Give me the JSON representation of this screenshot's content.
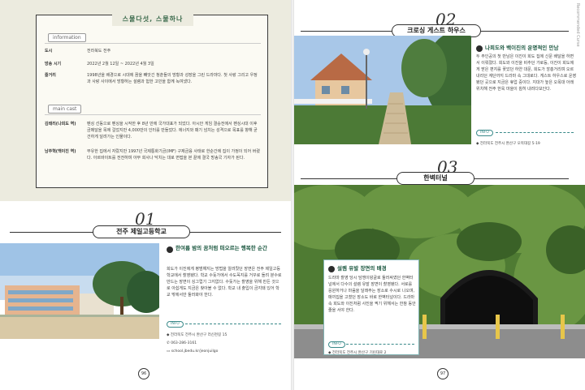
{
  "left_page": {
    "box_title": "스물다섯, 스물하나",
    "info_tag": "information",
    "info_rows": [
      {
        "key": "도시",
        "value": "전라북도 전주"
      },
      {
        "key": "방송 시기",
        "value": "2022년 2월 12일 ~ 2022년 4월 3일"
      },
      {
        "key": "줄거리",
        "value": "1998년을 배경으로 시대에 꿈을 빼앗긴 청춘들의 방황과 성장을 그린 드라마다. 첫 사랑 그리고 우정과 사랑 사이에서 방황하는 설렘과 험한 고민을 함께 녹여냈다."
      }
    ],
    "cast_tag": "main cast",
    "cast_rows": [
      {
        "key": "김태리(나희도 역)",
        "value": "펜싱 선동으로 펜싱을 시작한 후 8년 만에 국가대표가 되었다. 아시안 게임 결승전에서 펜싱시대 이후 금메달을 목에 걸었지만 4,000만의 인터를 만들었다. 에너지와 패기 넘치는 성격으로 목표를 향해 굳건하게 달려가는 인물이다."
      },
      {
        "key": "남주혁(백이진 역)",
        "value": "부유한 집에서 자랐지만 1997년 국제통화기금(IMF) 구제금융 사태로 한순간에 집이 가정이 되어 버렸다. 아르바이트를 전전하며 아무 회사나 닥치는 대로 면접을 본 끝에 결국 방송국 기자가 된다."
      }
    ],
    "section_num": "01",
    "section_title": "전주 제일고등학교",
    "card_title": "한여름 밤의 꿈처럼 떠오르는 행복한 순간",
    "card_text": "희도가 이진에게 평범해지는 방법을 알려줬던 장면은 전주 제일고등학교에서 촬영됐다. 학교 수돗가에서 수도꼭지를 거꾸로 돌려 분수로 만드는 장면이 싱그럽기 그지없다. 수돗가는 촬영을 위해 만든 것으로 아쉽게도 지금은 찾아볼 수 없다. 학교 내 출입이 금지돼 있어 학교 밖에서만 둘러봐야 한다.",
    "info_label": "INFO",
    "address": "전라북도 전주시 완산구 러신천길 15",
    "phone": "063-286-3161",
    "website": "school.jbedu.kr/jeonjuilgo",
    "page_number": "96"
  },
  "right_page": {
    "section1_num": "02",
    "section1_title": "크로싱 게스트 하우스",
    "card1_title": "나희도와 백이진의 운명적인 만남",
    "card1_text": "두 주인공의 첫 만남은 이진이 희도 집에 신문 배달을 하면서 이뤄졌다. 희도와 이진을 비추던 가로등, 이진이 희도에게 받은 편지를 꽂았던 하얀 대문, 희도가 깡총거리며 오르내리던 계단까지 드라마 속 그대로다. 게스트 하우스로 운영됐던 곳으로 지금은 휴업 중이다. 지대가 높은 오목대 아래 위치해 전주 한옥 마을이 훤히 내려다보인다.",
    "info1_label": "INFO",
    "address1": "전라북도 전주시 완산구 오목대길 5-19",
    "section2_num": "03",
    "section2_title": "한벽터널",
    "card2_title": "설렘 유발 장면의 배경",
    "card2_text": "드라마 촬영 당시 담쟁이덩굴로 둘러싸였던 한벽터널에서 다수의 설렘 유발 장면이 촬영됐다. 서로를 응원하거나 마음을 달래주는 장소로 수시로 나오며, 매끼집을 고쳤던 장소도 바로 한벽터널이다. 드라마 속 희도와 이진처럼 사진을 찍기 위해서는 한참 동안 줄을 서야 한다.",
    "info2_label": "INFO",
    "address2": "전라북도 전주시 완산구 기린대로 2",
    "page_number": "97",
    "vertical_label": "Recommended Curse"
  }
}
